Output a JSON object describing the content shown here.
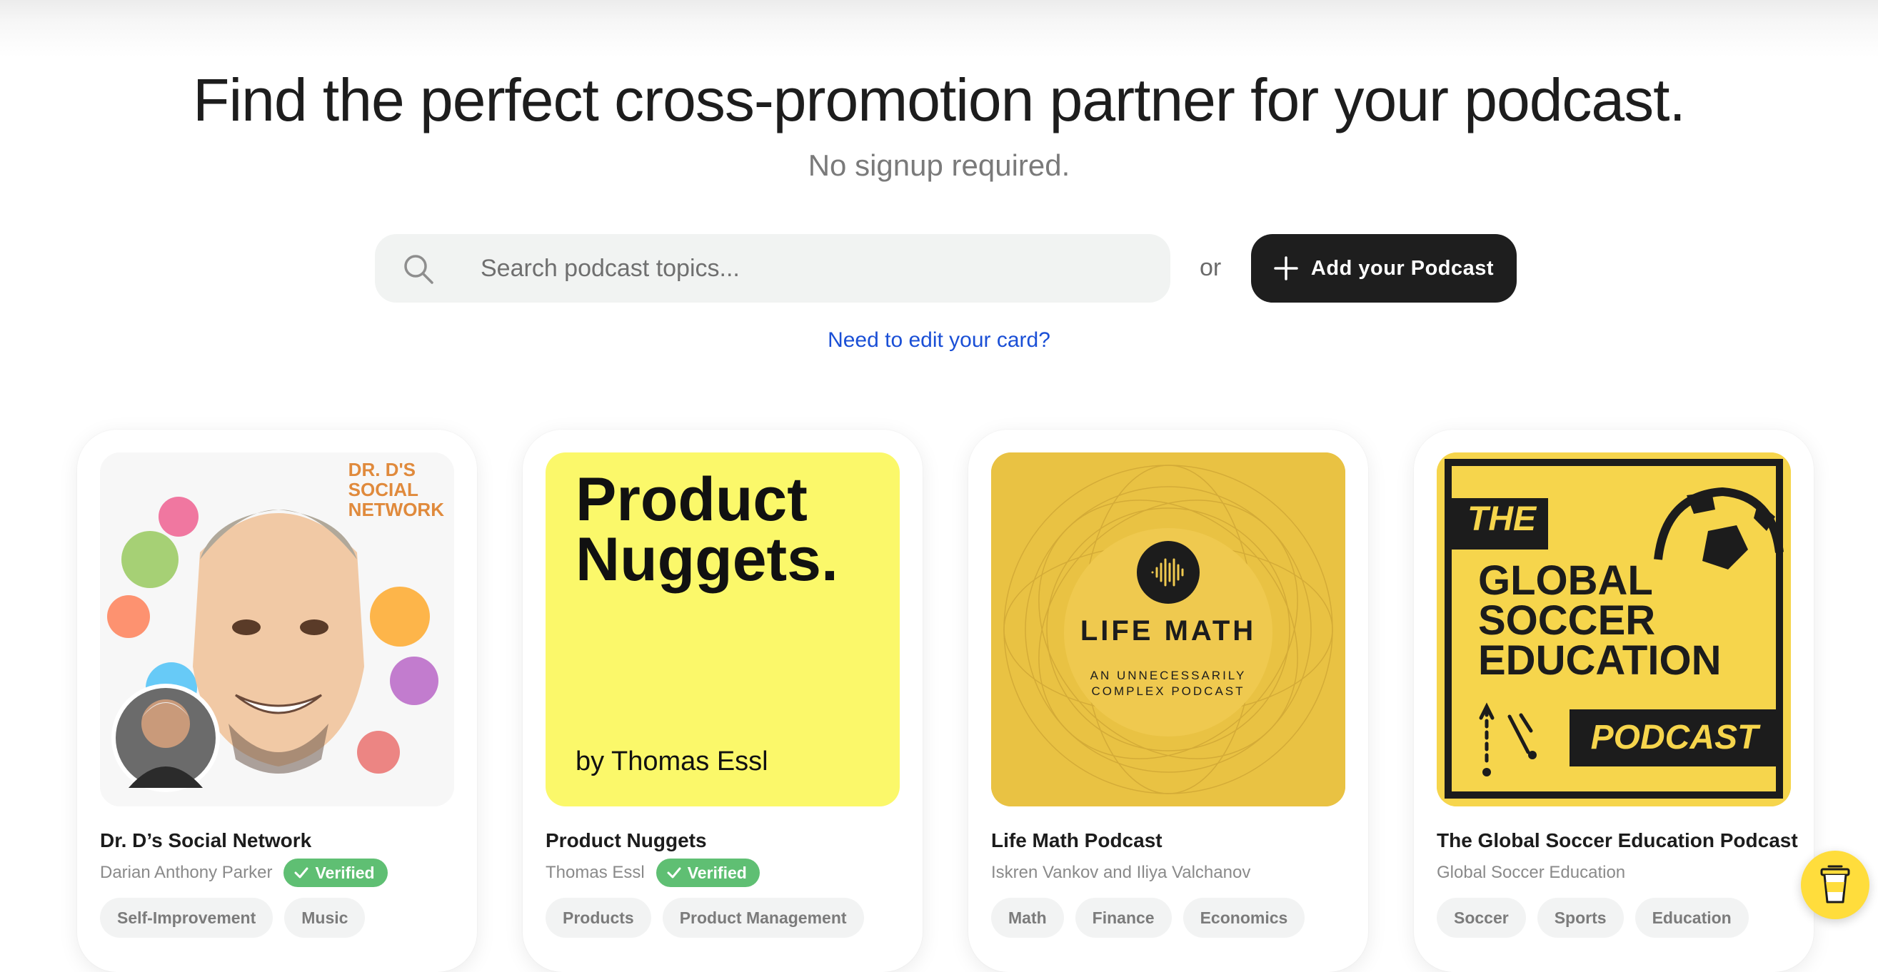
{
  "hero": {
    "title": "Find the perfect cross-promotion partner for your podcast.",
    "subtitle": "No signup required."
  },
  "search": {
    "placeholder": "Search podcast topics...",
    "value": ""
  },
  "or_label": "or",
  "add_button": {
    "label": "Add your Podcast",
    "icon": "plus-icon"
  },
  "edit_link": "Need to edit your card?",
  "cards": [
    {
      "title": "Dr. D’s Social Network",
      "author": "Darian Anthony Parker",
      "verified": "Verified",
      "art_text": [
        "DR. D'S",
        "SOCIAL",
        "NETWORK"
      ],
      "tags": [
        "Self-Improvement",
        "Music"
      ]
    },
    {
      "title": "Product Nuggets",
      "author": "Thomas Essl",
      "verified": "Verified",
      "art_text": [
        "Product",
        "Nuggets.",
        "by Thomas Essl"
      ],
      "tags": [
        "Products",
        "Product Management"
      ]
    },
    {
      "title": "Life Math Podcast",
      "author": "Iskren Vankov and Iliya Valchanov",
      "art_text": [
        "LIFE MATH",
        "AN UNNECESSARILY",
        "COMPLEX PODCAST"
      ],
      "tags": [
        "Math",
        "Finance",
        "Economics"
      ]
    },
    {
      "title": "The Global Soccer Education Podcast",
      "author": "Global Soccer Education",
      "art_text": [
        "THE",
        "GLOBAL",
        "SOCCER",
        "EDUCATION",
        "PODCAST"
      ],
      "tags": [
        "Soccer",
        "Sports",
        "Education"
      ]
    }
  ],
  "colors": {
    "accent_dark": "#1e1e1e",
    "link_blue": "#1a4fd6",
    "verified_green": "#5fbf73",
    "coffee_yellow": "#ffdd3c"
  },
  "coffee_button": {
    "icon": "coffee-cup-icon"
  }
}
